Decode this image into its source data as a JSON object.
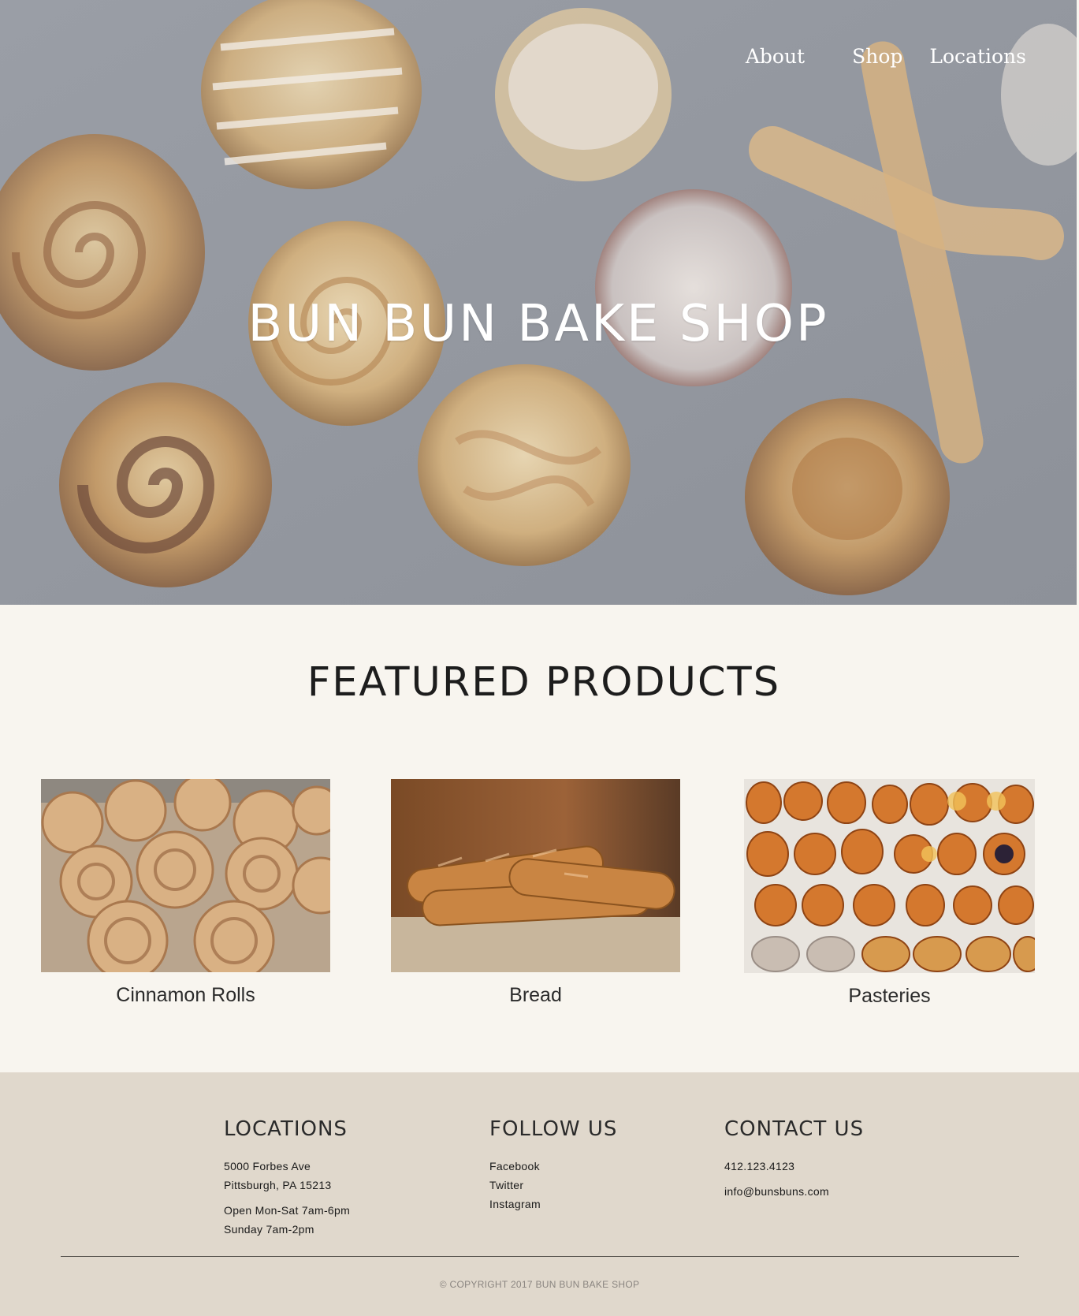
{
  "nav": {
    "items": [
      {
        "label": "About"
      },
      {
        "label": "Shop"
      },
      {
        "label": "Locations"
      }
    ]
  },
  "hero": {
    "title": "BUN BUN BAKE SHOP"
  },
  "featured": {
    "title": "FEATURED PRODUCTS",
    "products": [
      {
        "label": "Cinnamon Rolls",
        "image": "cinnamon-rolls-photo"
      },
      {
        "label": "Bread",
        "image": "bread-photo"
      },
      {
        "label": "Pasteries",
        "image": "pastries-photo"
      }
    ]
  },
  "footer": {
    "locations": {
      "heading": "LOCATIONS",
      "address_line1": "5000 Forbes Ave",
      "address_line2": "Pittsburgh, PA 15213",
      "hours_line1": "Open Mon-Sat 7am-6pm",
      "hours_line2": "Sunday 7am-2pm"
    },
    "follow": {
      "heading": "FOLLOW US",
      "links": [
        "Facebook",
        "Twitter",
        "Instagram"
      ]
    },
    "contact": {
      "heading": "CONTACT US",
      "phone": "412.123.4123",
      "email": "info@bunsbuns.com"
    },
    "copyright": "© COPYRIGHT 2017 BUN BUN BAKE SHOP"
  },
  "colors": {
    "page_background": "#f8f5ef",
    "footer_background": "#e0d8cc",
    "hero_overlay": "#8f949c",
    "text_dark": "#1d1d1d"
  }
}
